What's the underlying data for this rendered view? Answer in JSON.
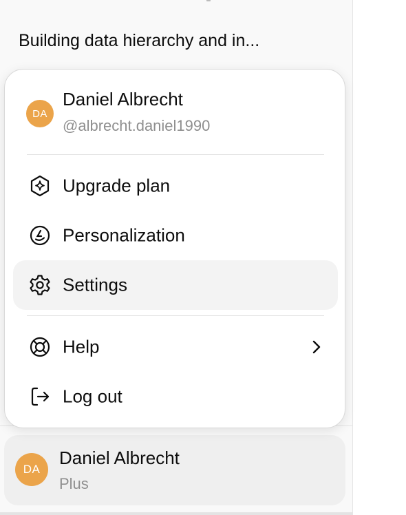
{
  "sidebar": {
    "history_item": "Building data hierarchy and in..."
  },
  "menu": {
    "user": {
      "name": "Daniel Albrecht",
      "handle": "@albrecht.daniel1990",
      "initials": "DA"
    },
    "items": [
      {
        "label": "Upgrade plan",
        "icon": "upgrade-sparkle-icon"
      },
      {
        "label": "Personalization",
        "icon": "personalization-icon"
      },
      {
        "label": "Settings",
        "icon": "gear-icon",
        "active": true
      },
      {
        "label": "Help",
        "icon": "help-lifebuoy-icon",
        "submenu": true
      },
      {
        "label": "Log out",
        "icon": "logout-icon"
      }
    ]
  },
  "account": {
    "name": "Daniel Albrecht",
    "plan": "Plus",
    "initials": "DA"
  },
  "colors": {
    "avatar": "#eba44a",
    "active_item_bg": "#f3f3f3",
    "secondary_text": "#8f8f8f"
  }
}
